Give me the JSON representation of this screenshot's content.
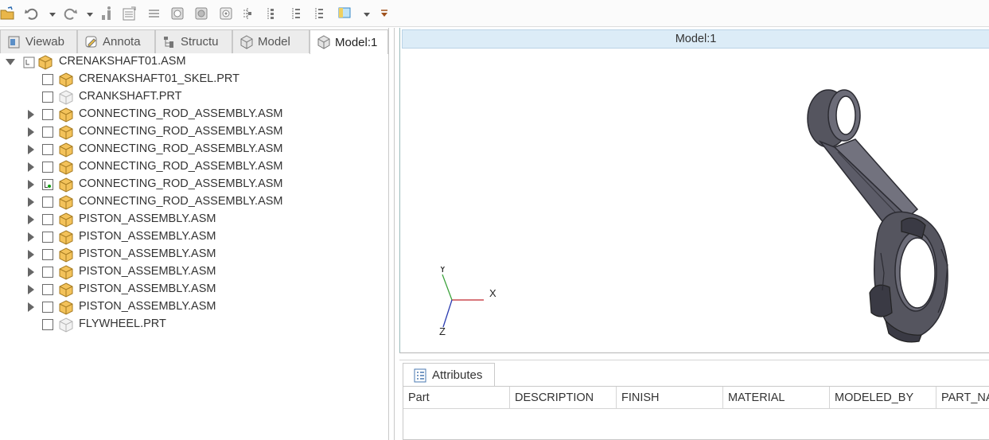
{
  "toolbar": {
    "icons": [
      "open-folder-icon",
      "undo-icon",
      "undo-dropdown-icon",
      "redo-icon",
      "redo-dropdown-icon",
      "regenerate-icon",
      "table-icon",
      "list-icon",
      "gear-box-icon",
      "cylinder-icon",
      "cylinder-hole-icon",
      "layer-icon",
      "tree-expand-icon",
      "tree-collapse-icon",
      "tree-filter-icon",
      "tree-settings-icon",
      "view-style-icon",
      "view-dropdown-icon",
      "customize-toolbar-icon"
    ]
  },
  "tabs": [
    {
      "label": "Viewab",
      "icon": "viewables-icon",
      "active": false
    },
    {
      "label": "Annota",
      "icon": "annotation-icon",
      "active": false
    },
    {
      "label": "Structu",
      "icon": "structure-icon",
      "active": false
    },
    {
      "label": "Model",
      "icon": "model-cube-icon",
      "active": false
    },
    {
      "label": "Model:1",
      "icon": "model-cube-icon",
      "active": true
    }
  ],
  "tree": {
    "root": {
      "label": "CRENAKSHAFT01.ASM",
      "icon": "assembly-icon",
      "expanded": true
    },
    "items": [
      {
        "label": "CRENAKSHAFT01_SKEL.PRT",
        "icon": "part-icon",
        "expandable": false,
        "checked": false
      },
      {
        "label": "CRANKSHAFT.PRT",
        "icon": "part-hidden-icon",
        "expandable": false,
        "checked": false
      },
      {
        "label": "CONNECTING_ROD_ASSEMBLY.ASM",
        "icon": "assembly-icon",
        "expandable": true,
        "checked": false
      },
      {
        "label": "CONNECTING_ROD_ASSEMBLY.ASM",
        "icon": "assembly-icon",
        "expandable": true,
        "checked": false
      },
      {
        "label": "CONNECTING_ROD_ASSEMBLY.ASM",
        "icon": "assembly-icon",
        "expandable": true,
        "checked": false
      },
      {
        "label": "CONNECTING_ROD_ASSEMBLY.ASM",
        "icon": "assembly-icon",
        "expandable": true,
        "checked": false
      },
      {
        "label": "CONNECTING_ROD_ASSEMBLY.ASM",
        "icon": "assembly-icon",
        "expandable": true,
        "checked": true
      },
      {
        "label": "CONNECTING_ROD_ASSEMBLY.ASM",
        "icon": "assembly-icon",
        "expandable": true,
        "checked": false
      },
      {
        "label": "PISTON_ASSEMBLY.ASM",
        "icon": "assembly-icon",
        "expandable": true,
        "checked": false
      },
      {
        "label": "PISTON_ASSEMBLY.ASM",
        "icon": "assembly-icon",
        "expandable": true,
        "checked": false
      },
      {
        "label": "PISTON_ASSEMBLY.ASM",
        "icon": "assembly-icon",
        "expandable": true,
        "checked": false
      },
      {
        "label": "PISTON_ASSEMBLY.ASM",
        "icon": "assembly-icon",
        "expandable": true,
        "checked": false
      },
      {
        "label": "PISTON_ASSEMBLY.ASM",
        "icon": "assembly-icon",
        "expandable": true,
        "checked": false
      },
      {
        "label": "PISTON_ASSEMBLY.ASM",
        "icon": "assembly-icon",
        "expandable": true,
        "checked": false
      },
      {
        "label": "FLYWHEEL.PRT",
        "icon": "part-hidden-icon",
        "expandable": false,
        "checked": false
      }
    ]
  },
  "viewport": {
    "title": "Model:1",
    "triad": {
      "x": "X",
      "y": "Y",
      "z": "Z"
    },
    "colors": {
      "x_axis": "#c0262d",
      "y_axis": "#3ba23b",
      "z_axis": "#2a3bb0",
      "model": "#5a5a68",
      "header_bg": "#dcecf7"
    }
  },
  "attributes": {
    "tab_label": "Attributes",
    "columns": [
      "Part",
      "DESCRIPTION",
      "FINISH",
      "MATERIAL",
      "MODELED_BY",
      "PART_NA"
    ]
  }
}
